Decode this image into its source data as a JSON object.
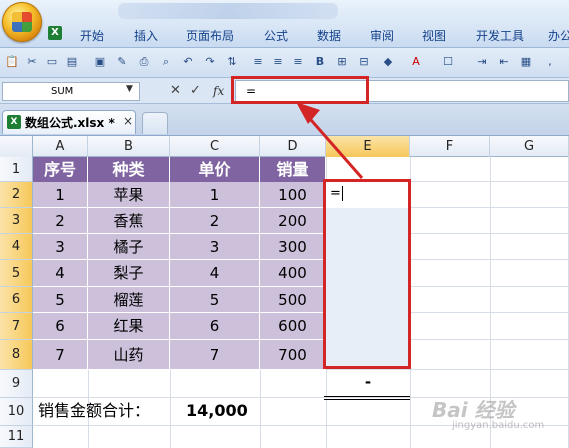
{
  "ribbon": {
    "tabs": [
      "开始",
      "插入",
      "页面布局",
      "公式",
      "数据",
      "审阅",
      "视图",
      "开发工具",
      "办公"
    ]
  },
  "formula_bar": {
    "name_box": "SUM",
    "cancel_symbol": "✕",
    "enter_symbol": "✓",
    "fx_label": "fx",
    "formula": "="
  },
  "workbook_tab": {
    "icon_letter": "X",
    "filename": "数组公式.xlsx *",
    "close": "×"
  },
  "columns": [
    "A",
    "B",
    "C",
    "D",
    "E",
    "F",
    "G"
  ],
  "rows": [
    "1",
    "2",
    "3",
    "4",
    "5",
    "6",
    "7",
    "8",
    "9",
    "10",
    "11"
  ],
  "table": {
    "headers": [
      "序号",
      "种类",
      "单价",
      "销量"
    ],
    "data": [
      [
        "1",
        "苹果",
        "1",
        "100"
      ],
      [
        "2",
        "香蕉",
        "2",
        "200"
      ],
      [
        "3",
        "橘子",
        "3",
        "300"
      ],
      [
        "4",
        "梨子",
        "4",
        "400"
      ],
      [
        "5",
        "榴莲",
        "5",
        "500"
      ],
      [
        "6",
        "红果",
        "6",
        "600"
      ],
      [
        "7",
        "山药",
        "7",
        "700"
      ]
    ]
  },
  "active_cell": {
    "content": "="
  },
  "e9_value": "-",
  "total": {
    "label": "销售金额合计：",
    "value": "14,000"
  },
  "watermark": {
    "main": "Bai 经验",
    "sub": "jingyan.baidu.com"
  },
  "colors": {
    "highlight": "#d32525",
    "header_fill": "#8064a2",
    "data_fill": "#ccc0da"
  }
}
